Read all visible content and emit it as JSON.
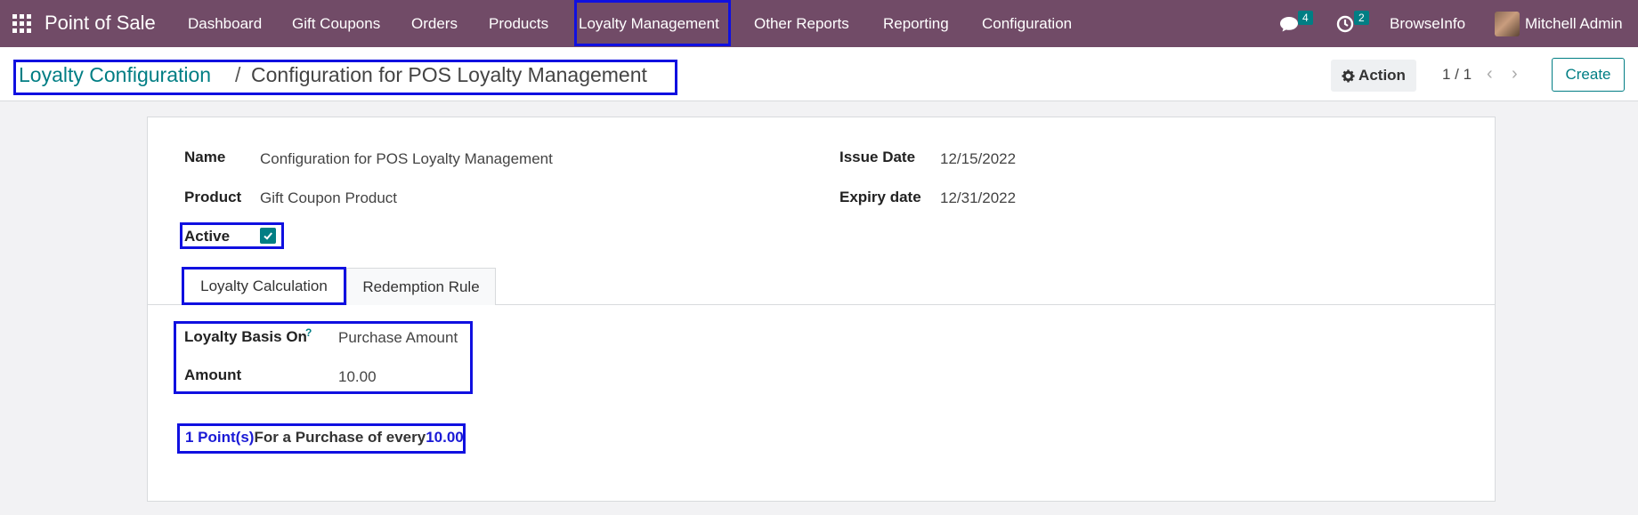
{
  "navbar": {
    "brand": "Point of Sale",
    "menu": [
      "Dashboard",
      "Gift Coupons",
      "Orders",
      "Products",
      "Loyalty Management",
      "Other Reports",
      "Reporting",
      "Configuration"
    ],
    "messages_count": "4",
    "activities_count": "2",
    "company": "BrowseInfo",
    "user": "Mitchell Admin"
  },
  "breadcrumb": {
    "parent": "Loyalty Configuration",
    "separator": "/",
    "current": "Configuration for POS Loyalty Management"
  },
  "control": {
    "action_label": "Action",
    "pager": "1 / 1",
    "create_label": "Create"
  },
  "form": {
    "name_label": "Name",
    "name_value": "Configuration for POS Loyalty Management",
    "product_label": "Product",
    "product_value": "Gift Coupon Product",
    "issue_date_label": "Issue Date",
    "issue_date_value": "12/15/2022",
    "expiry_date_label": "Expiry date",
    "expiry_date_value": "12/31/2022",
    "active_label": "Active",
    "active_checked": true,
    "tabs": [
      "Loyalty Calculation",
      "Redemption Rule"
    ],
    "basis_label": "Loyalty Basis On",
    "basis_help": "?",
    "basis_value": "Purchase Amount",
    "amount_label": "Amount",
    "amount_value": "10.00",
    "summary_points": "1 Point(s)",
    "summary_text": "For a Purchase of every",
    "summary_amount": "10.00"
  },
  "colors": {
    "navbar": "#714b67",
    "accent": "#017e84",
    "highlight": "#1010e0"
  }
}
